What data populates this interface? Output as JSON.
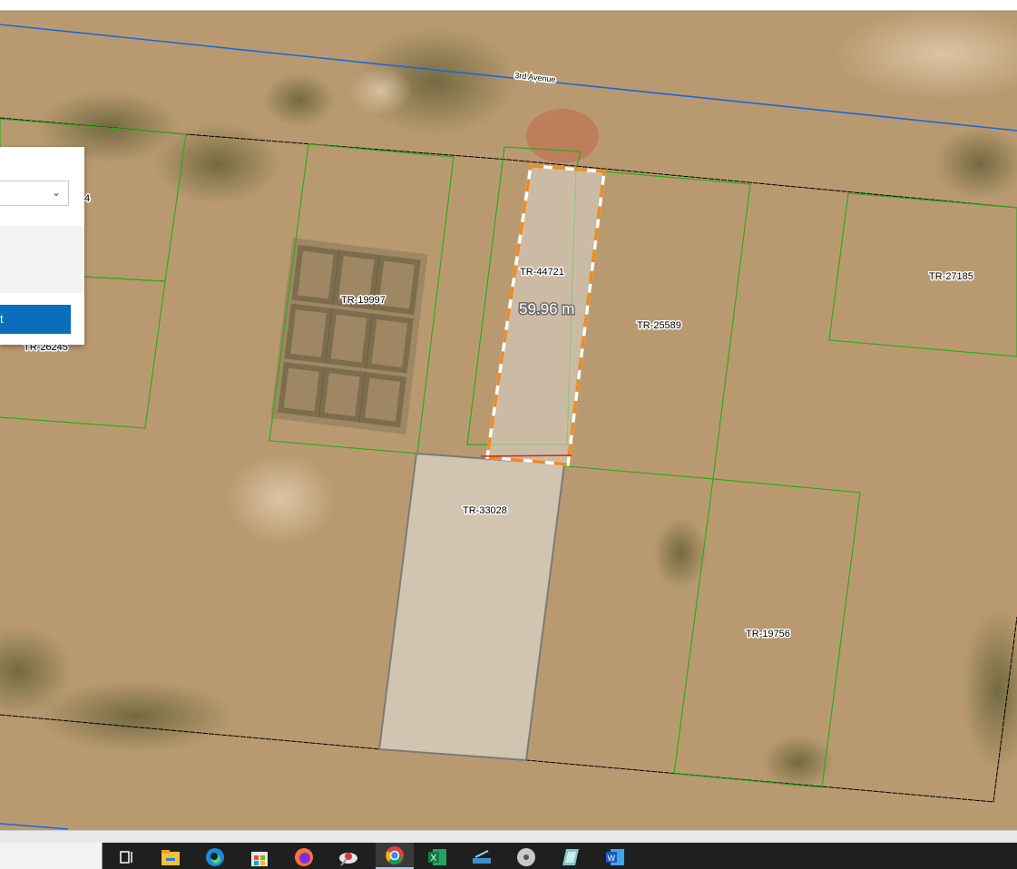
{
  "map": {
    "road_label": "3rd Avenue",
    "measurement_label": "59.96 m",
    "parcels": [
      {
        "id": "TR-44721"
      },
      {
        "id": "TR-19997"
      },
      {
        "id": "TR-25589"
      },
      {
        "id": "TR-27185"
      },
      {
        "id": "TR-33028"
      },
      {
        "id": "TR-19756"
      },
      {
        "id": "TR-26245"
      }
    ],
    "partial_label": "4",
    "colors": {
      "parcel_line": "#2eaa1b",
      "road_line": "#1a66dd",
      "boundary_line": "#000000",
      "selection": "#f08a24",
      "measure_line": "#e02020",
      "highlight_fill": "#d9d2c6"
    }
  },
  "panel": {
    "dropdown_value": "",
    "button_label": "t"
  },
  "taskbar": {
    "icons": [
      "task-view-icon",
      "file-explorer-icon",
      "edge-icon",
      "store-icon",
      "firefox-icon",
      "satellite-app-icon",
      "chrome-icon",
      "excel-icon",
      "scanner-icon",
      "disk-icon",
      "app-icon",
      "word-icon"
    ],
    "active": "chrome-icon"
  }
}
